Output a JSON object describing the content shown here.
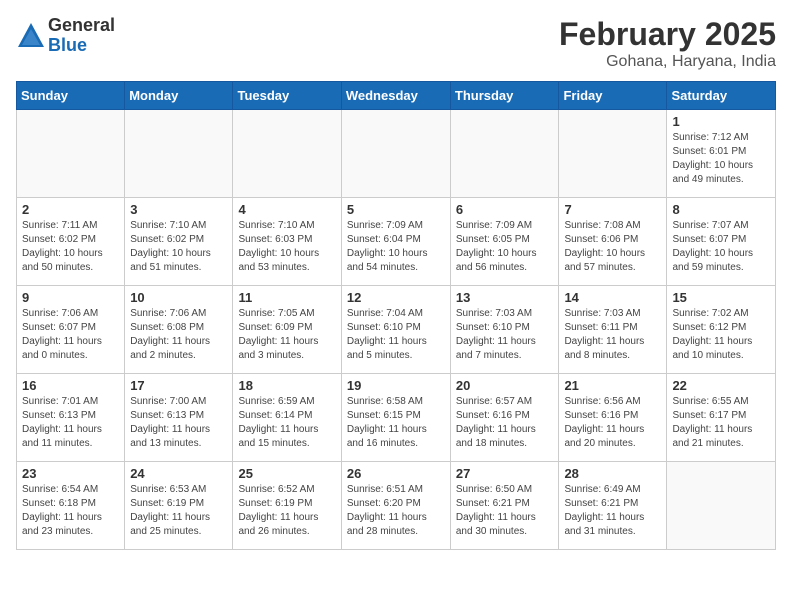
{
  "header": {
    "logo_general": "General",
    "logo_blue": "Blue",
    "month_title": "February 2025",
    "location": "Gohana, Haryana, India"
  },
  "calendar": {
    "days_of_week": [
      "Sunday",
      "Monday",
      "Tuesday",
      "Wednesday",
      "Thursday",
      "Friday",
      "Saturday"
    ],
    "weeks": [
      [
        {
          "day": "",
          "info": ""
        },
        {
          "day": "",
          "info": ""
        },
        {
          "day": "",
          "info": ""
        },
        {
          "day": "",
          "info": ""
        },
        {
          "day": "",
          "info": ""
        },
        {
          "day": "",
          "info": ""
        },
        {
          "day": "1",
          "info": "Sunrise: 7:12 AM\nSunset: 6:01 PM\nDaylight: 10 hours and 49 minutes."
        }
      ],
      [
        {
          "day": "2",
          "info": "Sunrise: 7:11 AM\nSunset: 6:02 PM\nDaylight: 10 hours and 50 minutes."
        },
        {
          "day": "3",
          "info": "Sunrise: 7:10 AM\nSunset: 6:02 PM\nDaylight: 10 hours and 51 minutes."
        },
        {
          "day": "4",
          "info": "Sunrise: 7:10 AM\nSunset: 6:03 PM\nDaylight: 10 hours and 53 minutes."
        },
        {
          "day": "5",
          "info": "Sunrise: 7:09 AM\nSunset: 6:04 PM\nDaylight: 10 hours and 54 minutes."
        },
        {
          "day": "6",
          "info": "Sunrise: 7:09 AM\nSunset: 6:05 PM\nDaylight: 10 hours and 56 minutes."
        },
        {
          "day": "7",
          "info": "Sunrise: 7:08 AM\nSunset: 6:06 PM\nDaylight: 10 hours and 57 minutes."
        },
        {
          "day": "8",
          "info": "Sunrise: 7:07 AM\nSunset: 6:07 PM\nDaylight: 10 hours and 59 minutes."
        }
      ],
      [
        {
          "day": "9",
          "info": "Sunrise: 7:06 AM\nSunset: 6:07 PM\nDaylight: 11 hours and 0 minutes."
        },
        {
          "day": "10",
          "info": "Sunrise: 7:06 AM\nSunset: 6:08 PM\nDaylight: 11 hours and 2 minutes."
        },
        {
          "day": "11",
          "info": "Sunrise: 7:05 AM\nSunset: 6:09 PM\nDaylight: 11 hours and 3 minutes."
        },
        {
          "day": "12",
          "info": "Sunrise: 7:04 AM\nSunset: 6:10 PM\nDaylight: 11 hours and 5 minutes."
        },
        {
          "day": "13",
          "info": "Sunrise: 7:03 AM\nSunset: 6:10 PM\nDaylight: 11 hours and 7 minutes."
        },
        {
          "day": "14",
          "info": "Sunrise: 7:03 AM\nSunset: 6:11 PM\nDaylight: 11 hours and 8 minutes."
        },
        {
          "day": "15",
          "info": "Sunrise: 7:02 AM\nSunset: 6:12 PM\nDaylight: 11 hours and 10 minutes."
        }
      ],
      [
        {
          "day": "16",
          "info": "Sunrise: 7:01 AM\nSunset: 6:13 PM\nDaylight: 11 hours and 11 minutes."
        },
        {
          "day": "17",
          "info": "Sunrise: 7:00 AM\nSunset: 6:13 PM\nDaylight: 11 hours and 13 minutes."
        },
        {
          "day": "18",
          "info": "Sunrise: 6:59 AM\nSunset: 6:14 PM\nDaylight: 11 hours and 15 minutes."
        },
        {
          "day": "19",
          "info": "Sunrise: 6:58 AM\nSunset: 6:15 PM\nDaylight: 11 hours and 16 minutes."
        },
        {
          "day": "20",
          "info": "Sunrise: 6:57 AM\nSunset: 6:16 PM\nDaylight: 11 hours and 18 minutes."
        },
        {
          "day": "21",
          "info": "Sunrise: 6:56 AM\nSunset: 6:16 PM\nDaylight: 11 hours and 20 minutes."
        },
        {
          "day": "22",
          "info": "Sunrise: 6:55 AM\nSunset: 6:17 PM\nDaylight: 11 hours and 21 minutes."
        }
      ],
      [
        {
          "day": "23",
          "info": "Sunrise: 6:54 AM\nSunset: 6:18 PM\nDaylight: 11 hours and 23 minutes."
        },
        {
          "day": "24",
          "info": "Sunrise: 6:53 AM\nSunset: 6:19 PM\nDaylight: 11 hours and 25 minutes."
        },
        {
          "day": "25",
          "info": "Sunrise: 6:52 AM\nSunset: 6:19 PM\nDaylight: 11 hours and 26 minutes."
        },
        {
          "day": "26",
          "info": "Sunrise: 6:51 AM\nSunset: 6:20 PM\nDaylight: 11 hours and 28 minutes."
        },
        {
          "day": "27",
          "info": "Sunrise: 6:50 AM\nSunset: 6:21 PM\nDaylight: 11 hours and 30 minutes."
        },
        {
          "day": "28",
          "info": "Sunrise: 6:49 AM\nSunset: 6:21 PM\nDaylight: 11 hours and 31 minutes."
        },
        {
          "day": "",
          "info": ""
        }
      ]
    ]
  }
}
